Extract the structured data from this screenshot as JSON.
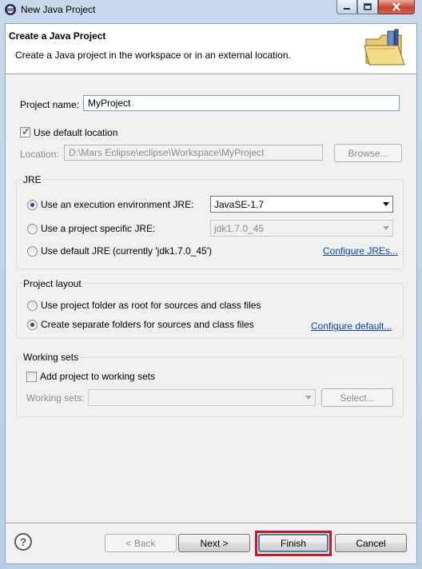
{
  "window": {
    "title": "New Java Project",
    "icon": "eclipse-icon",
    "controls": [
      "minimize-icon",
      "maximize-icon",
      "close-icon"
    ]
  },
  "banner": {
    "title": "Create a Java Project",
    "description": "Create a Java project in the workspace or in an external location.",
    "image": "folder-wizard-icon"
  },
  "project": {
    "name_label": "Project name:",
    "name_value": "MyProject",
    "use_default_location_label": "Use default location",
    "use_default_location_checked": true,
    "location_label": "Location:",
    "location_value": "D:\\Mars Eclipse\\eclipse\\Workspace\\MyProject",
    "browse_label": "Browse..."
  },
  "jre": {
    "group_title": "JRE",
    "option_env_label": "Use an execution environment JRE:",
    "option_env_value": "JavaSE-1.7",
    "option_specific_label": "Use a project specific JRE:",
    "option_specific_value": "jdk1.7.0_45",
    "option_default_label": "Use default JRE (currently 'jdk1.7.0_45')",
    "configure_link": "Configure JREs...",
    "selected": "env"
  },
  "layout": {
    "group_title": "Project layout",
    "option_root_label": "Use project folder as root for sources and class files",
    "option_separate_label": "Create separate folders for sources and class files",
    "configure_link": "Configure default...",
    "selected": "separate"
  },
  "working_sets": {
    "group_title": "Working sets",
    "add_label": "Add project to working sets",
    "add_checked": false,
    "sets_label": "Working sets:",
    "sets_value": "",
    "select_label": "Select..."
  },
  "footer": {
    "help_symbol": "?",
    "back_label": "< Back",
    "next_label": "Next >",
    "finish_label": "Finish",
    "cancel_label": "Cancel"
  },
  "colors": {
    "highlight": "#d2141c",
    "link": "#0645ad",
    "titlebar": "#c7d8ea"
  }
}
